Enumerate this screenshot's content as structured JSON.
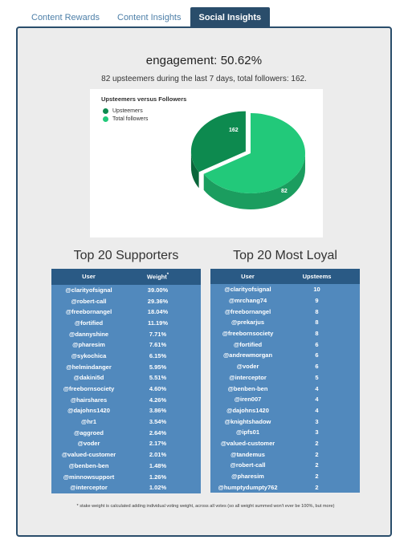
{
  "tabs": [
    {
      "label": "Content Rewards",
      "active": false
    },
    {
      "label": "Content Insights",
      "active": false
    },
    {
      "label": "Social Insights",
      "active": true
    }
  ],
  "header": {
    "engagement": "engagement: 50.62%",
    "subline": "82 upsteemers during the last 7 days, total followers: 162."
  },
  "chart_data": {
    "type": "pie",
    "title": "Upsteemers versus Followers",
    "categories": [
      "Upsteemers",
      "Total followers"
    ],
    "values": [
      82,
      162
    ],
    "labels": [
      "82",
      "162"
    ],
    "colors": [
      "#0d8a4f",
      "#22c97a"
    ],
    "legend": [
      {
        "label": "Upsteemers",
        "color": "#0d8a4f"
      },
      {
        "label": "Total followers",
        "color": "#22c97a"
      }
    ],
    "legend_position": "top-left",
    "exploded_slice": "Upsteemers",
    "three_d": true
  },
  "supporters": {
    "caption": "Top 20 Supporters",
    "columns": [
      "User",
      "Weight",
      "*"
    ],
    "rows": [
      {
        "user": "@clarityofsignal",
        "value": "39.00%"
      },
      {
        "user": "@robert-call",
        "value": "29.36%"
      },
      {
        "user": "@freebornangel",
        "value": "18.04%"
      },
      {
        "user": "@fortified",
        "value": "11.19%"
      },
      {
        "user": "@dannyshine",
        "value": "7.71%"
      },
      {
        "user": "@pharesim",
        "value": "7.61%"
      },
      {
        "user": "@sykochica",
        "value": "6.15%"
      },
      {
        "user": "@helmindanger",
        "value": "5.95%"
      },
      {
        "user": "@dakini5d",
        "value": "5.51%"
      },
      {
        "user": "@freebornsociety",
        "value": "4.60%"
      },
      {
        "user": "@hairshares",
        "value": "4.26%"
      },
      {
        "user": "@dajohns1420",
        "value": "3.86%"
      },
      {
        "user": "@hr1",
        "value": "3.54%"
      },
      {
        "user": "@aggroed",
        "value": "2.64%"
      },
      {
        "user": "@voder",
        "value": "2.17%"
      },
      {
        "user": "@valued-customer",
        "value": "2.01%"
      },
      {
        "user": "@benben-ben",
        "value": "1.48%"
      },
      {
        "user": "@minnowsupport",
        "value": "1.26%"
      },
      {
        "user": "@interceptor",
        "value": "1.02%"
      }
    ]
  },
  "loyal": {
    "caption": "Top 20 Most Loyal",
    "columns": [
      "User",
      "Upsteems"
    ],
    "rows": [
      {
        "user": "@clarityofsignal",
        "value": "10"
      },
      {
        "user": "@mrchang74",
        "value": "9"
      },
      {
        "user": "@freebornangel",
        "value": "8"
      },
      {
        "user": "@prekarjus",
        "value": "8"
      },
      {
        "user": "@freebornsociety",
        "value": "8"
      },
      {
        "user": "@fortified",
        "value": "6"
      },
      {
        "user": "@andrewmorgan",
        "value": "6"
      },
      {
        "user": "@voder",
        "value": "6"
      },
      {
        "user": "@interceptor",
        "value": "5"
      },
      {
        "user": "@benben-ben",
        "value": "4"
      },
      {
        "user": "@iren007",
        "value": "4"
      },
      {
        "user": "@dajohns1420",
        "value": "4"
      },
      {
        "user": "@knightshadow",
        "value": "3"
      },
      {
        "user": "@ipfs01",
        "value": "3"
      },
      {
        "user": "@valued-customer",
        "value": "2"
      },
      {
        "user": "@tandemus",
        "value": "2"
      },
      {
        "user": "@robert-call",
        "value": "2"
      },
      {
        "user": "@pharesim",
        "value": "2"
      },
      {
        "user": "@humptydumpty762",
        "value": "2"
      }
    ]
  },
  "footnote": "* stake weight is calculated adding individual voting weight, across all votes (so all weight summed won't ever be 100%, but more)"
}
